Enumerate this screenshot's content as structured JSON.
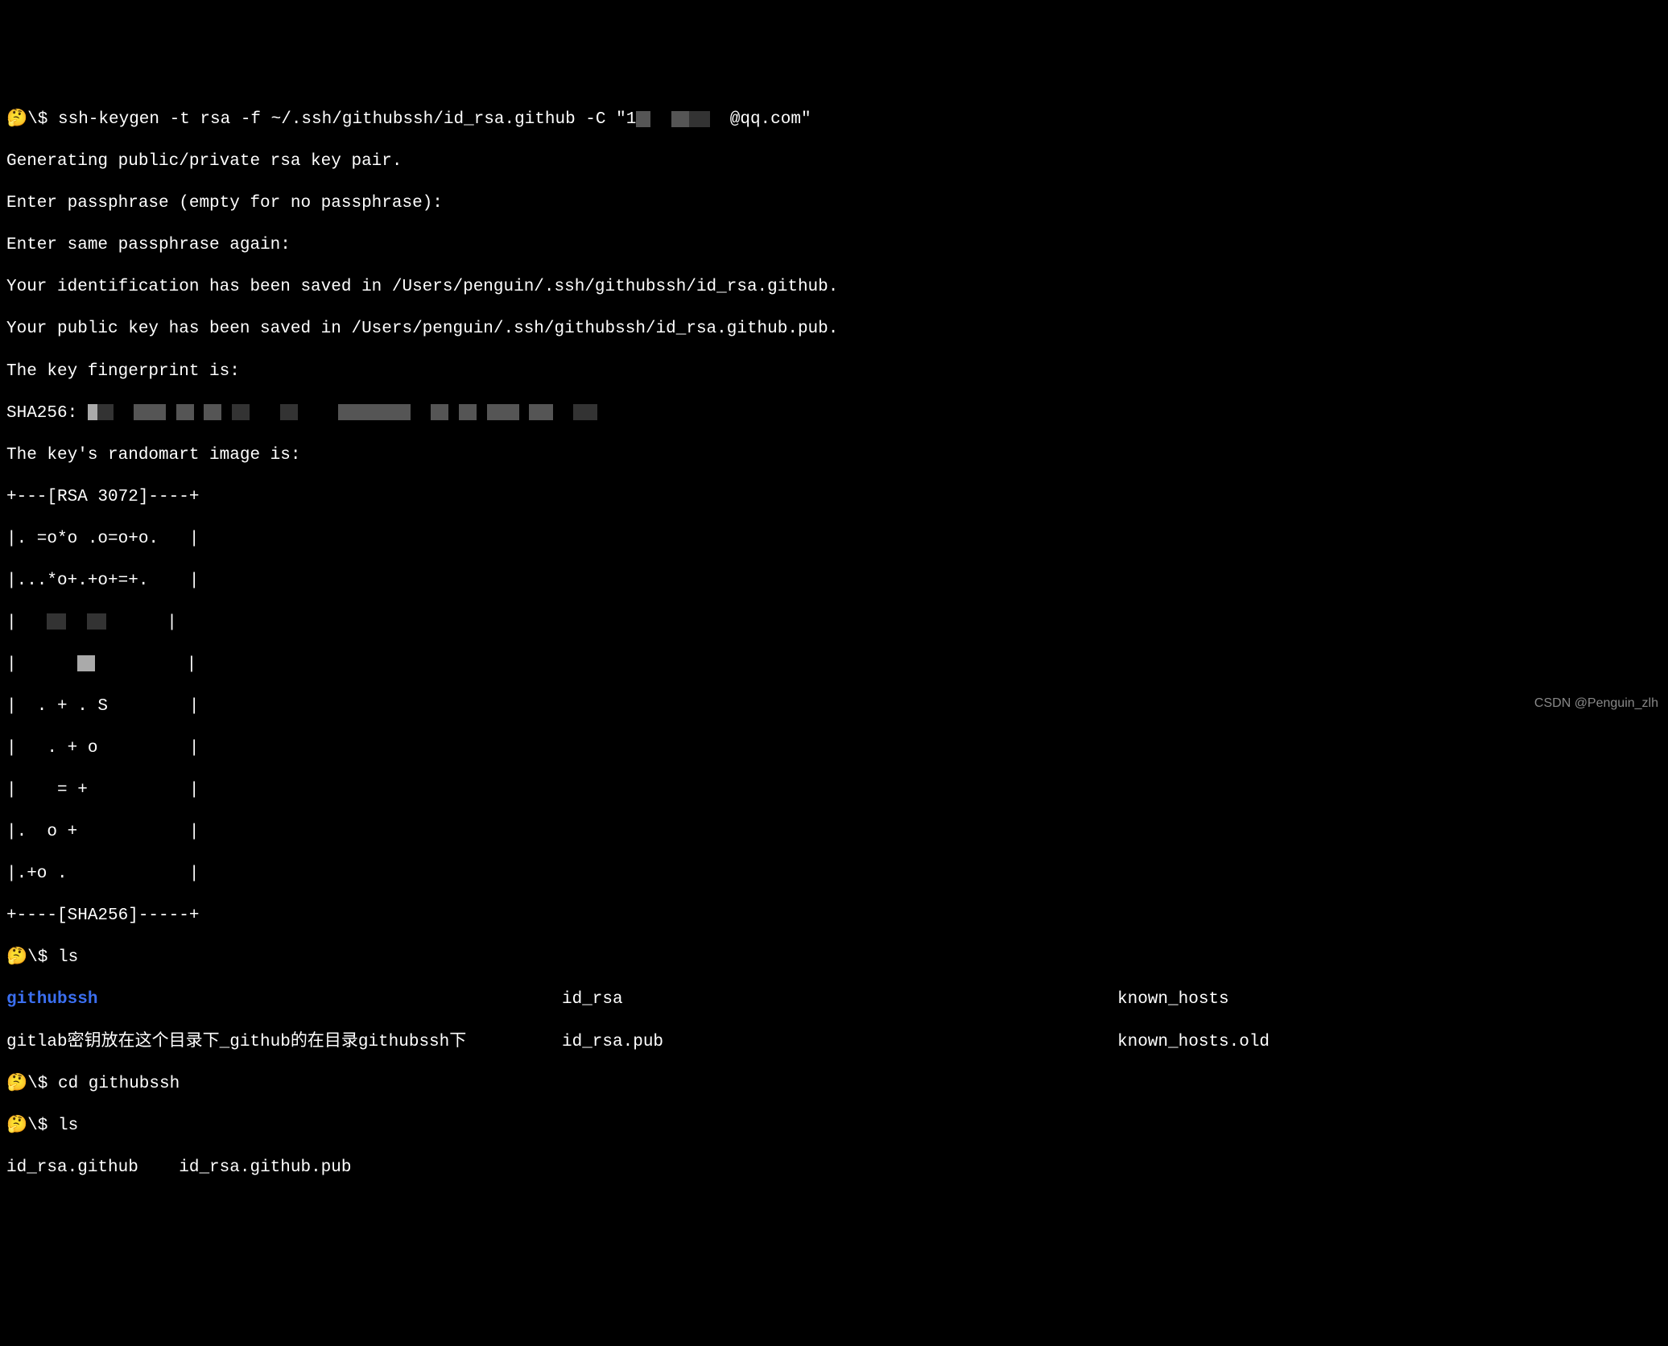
{
  "prompt": {
    "emoji": "🤔",
    "symbol": "\\$"
  },
  "commands": {
    "cmd1": "ssh-keygen -t rsa -f ~/.ssh/githubssh/id_rsa.github -C \"1",
    "cmd1_suffix": "@qq.com\"",
    "cmd2": "ls",
    "cmd3": "cd githubssh",
    "cmd4": "ls"
  },
  "output": {
    "generating": "Generating public/private rsa key pair.",
    "passphrase1": "Enter passphrase (empty for no passphrase):",
    "passphrase2": "Enter same passphrase again:",
    "saved_id": "Your identification has been saved in /Users/penguin/.ssh/githubssh/id_rsa.github.",
    "saved_pub": "Your public key has been saved in /Users/penguin/.ssh/githubssh/id_rsa.github.pub.",
    "fingerprint_label": "The key fingerprint is:",
    "sha_prefix": "SHA256:",
    "randomart_label": "The key's randomart image is:",
    "randomart": {
      "l0": "+---[RSA 3072]----+",
      "l1": "|. =o*o .o=o+o.   |",
      "l2": "|...*o+.+o+=+.    |",
      "l3": "|                 |",
      "l4": "|                 |",
      "l5": "|  . + . S        |",
      "l6": "|   . + o         |",
      "l7": "|    = +          |",
      "l8": "|.  o +           |",
      "l9": "|.+o .            |",
      "l10": "+----[SHA256]-----+"
    }
  },
  "ls1": {
    "githubssh": "githubssh",
    "note": "gitlab密钥放在这个目录下_github的在目录githubssh下",
    "id_rsa": "id_rsa",
    "id_rsa_pub": "id_rsa.pub",
    "known_hosts": "known_hosts",
    "known_hosts_old": "known_hosts.old"
  },
  "ls2": {
    "file1": "id_rsa.github",
    "file2": "id_rsa.github.pub"
  },
  "watermark": "CSDN @Penguin_zlh"
}
